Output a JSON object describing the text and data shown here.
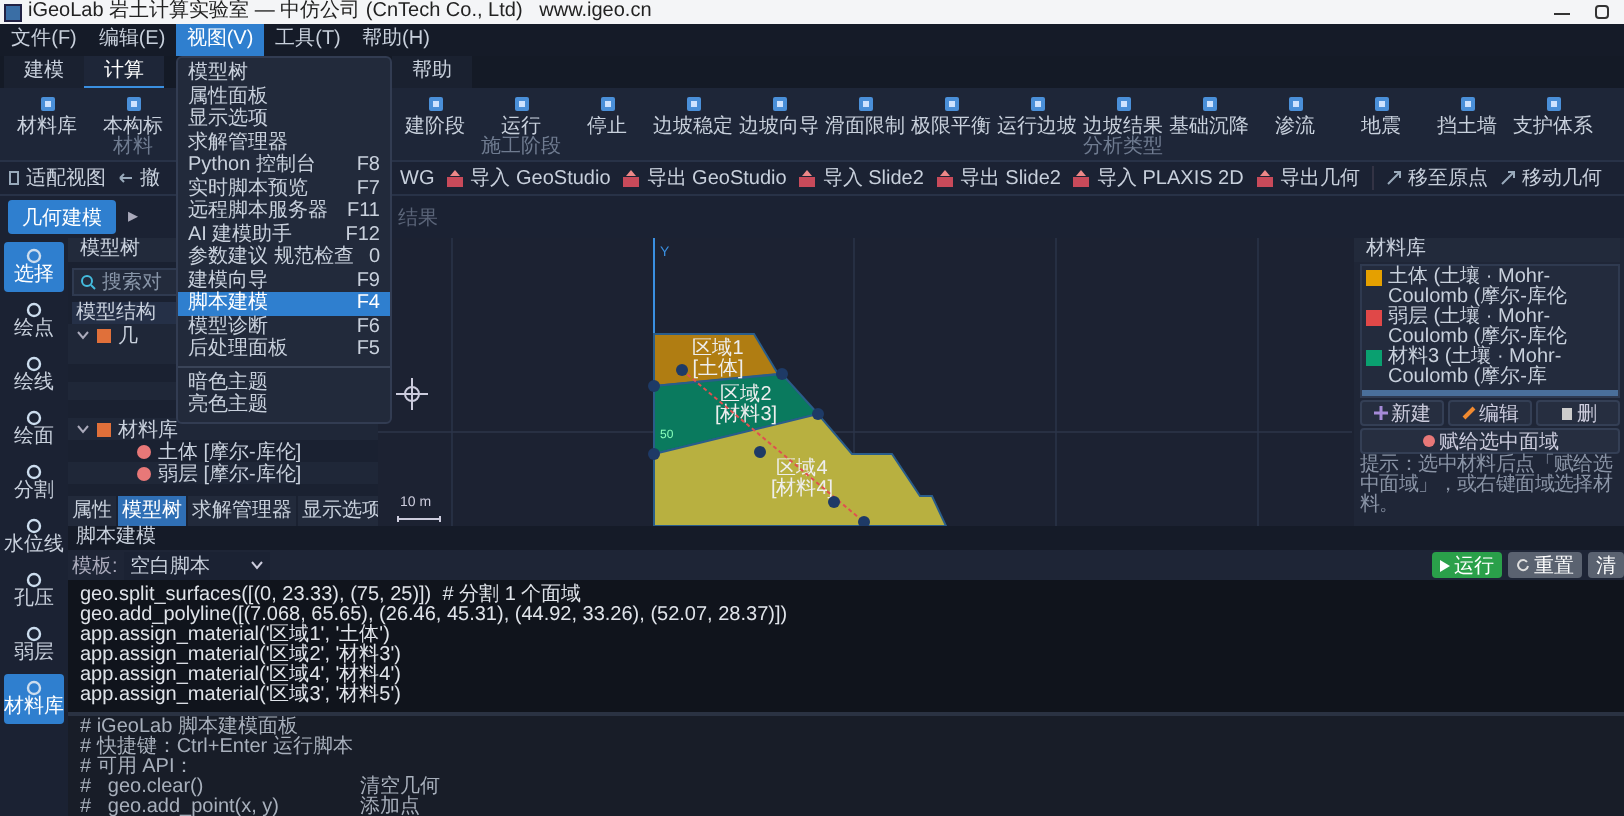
{
  "window": {
    "title": "iGeoLab 岩土计算实验室 — 中仿公司 (CnTech Co., Ltd)   www.igeo.cn"
  },
  "menu": [
    {
      "label": "文件(F)",
      "selected": false
    },
    {
      "label": "编辑(E)",
      "selected": false
    },
    {
      "label": "视图(V)",
      "selected": true
    },
    {
      "label": "工具(T)",
      "selected": false
    },
    {
      "label": "帮助(H)",
      "selected": false
    }
  ],
  "view_menu": {
    "groups": [
      [
        {
          "label": "模型树",
          "selected": false
        },
        {
          "label": "属性面板",
          "selected": false
        },
        {
          "label": "显示选项",
          "selected": false
        },
        {
          "label": "求解管理器",
          "selected": false
        },
        {
          "label": "Python 控制台",
          "shortcut": "F8",
          "selected": false
        },
        {
          "label": "实时脚本预览",
          "shortcut": "F7",
          "selected": false
        },
        {
          "label": "远程脚本服务器",
          "shortcut": "F11",
          "selected": false
        },
        {
          "label": "AI 建模助手",
          "shortcut": "F12",
          "selected": false
        },
        {
          "label": "参数建议  规范检查",
          "shortcut": "0",
          "selected": false
        },
        {
          "label": "建模向导",
          "shortcut": "F9",
          "selected": false
        },
        {
          "label": "脚本建模",
          "shortcut": "F4",
          "selected": true
        },
        {
          "label": "模型诊断",
          "shortcut": "F6",
          "selected": false
        },
        {
          "label": "后处理面板",
          "shortcut": "F5",
          "selected": false
        }
      ],
      [
        {
          "label": "暗色主题",
          "selected": false
        },
        {
          "label": "亮色主题",
          "selected": false
        }
      ]
    ]
  },
  "ribbon_tabs": [
    {
      "label": "建模",
      "selected": false
    },
    {
      "label": "计算",
      "selected": true
    },
    {
      "label": "帮助",
      "selected": false
    }
  ],
  "ribbon_tools": [
    {
      "label": "材料库"
    },
    {
      "label": "本构标",
      "group_label": "材料"
    },
    {
      "label": "建阶段"
    },
    {
      "label": "运行",
      "group_label": "施工阶段"
    },
    {
      "label": "停止"
    },
    {
      "label": "边坡稳定"
    },
    {
      "label": "边坡向导"
    },
    {
      "label": "滑面限制"
    },
    {
      "label": "极限平衡"
    },
    {
      "label": "运行边坡"
    },
    {
      "label": "边坡结果",
      "group_label": "分析类型"
    },
    {
      "label": "基础沉降"
    },
    {
      "label": "渗流"
    },
    {
      "label": "地震"
    },
    {
      "label": "挡土墙"
    },
    {
      "label": "支护体系"
    }
  ],
  "toolbar": [
    {
      "label": "适配视图",
      "kind": "fit"
    },
    {
      "label": "撤",
      "kind": "undo"
    },
    {
      "label": "WG",
      "kind": "text"
    },
    {
      "label": "导入 GeoStudio",
      "kind": "file"
    },
    {
      "label": "导出 GeoStudio",
      "kind": "file"
    },
    {
      "label": "导入 Slide2",
      "kind": "file"
    },
    {
      "label": "导出 Slide2",
      "kind": "file"
    },
    {
      "label": "导入 PLAXIS 2D",
      "kind": "file"
    },
    {
      "label": "导出几何",
      "kind": "file"
    },
    {
      "label": "移至原点",
      "kind": "move"
    },
    {
      "label": "移动几何",
      "kind": "move"
    }
  ],
  "mode_bar": {
    "button": "几何建模",
    "arrow": "▸",
    "next": "结果"
  },
  "left_rail": [
    {
      "label": "选择",
      "selected": true
    },
    {
      "label": "绘点",
      "selected": false
    },
    {
      "label": "绘线",
      "selected": false
    },
    {
      "label": "绘面",
      "selected": false
    },
    {
      "label": "分割",
      "selected": false
    },
    {
      "label": "水位线",
      "selected": false
    },
    {
      "label": "孔压",
      "selected": false
    },
    {
      "label": "弱层",
      "selected": false
    },
    {
      "label": "材料库",
      "selected": true
    }
  ],
  "model_tree": {
    "title": "模型树",
    "search": {
      "placeholder": "搜索对"
    },
    "header": "模型结构",
    "nodes": [
      {
        "label": "几",
        "expanded": true
      },
      {
        "label": "材料库",
        "expanded": true,
        "children": [
          {
            "label": "土体",
            "model": "[摩尔-库伦]"
          },
          {
            "label": "弱层",
            "model": "[摩尔-库伦]"
          }
        ]
      }
    ],
    "tabs": [
      {
        "label": "属性",
        "selected": false
      },
      {
        "label": "模型树",
        "selected": true
      },
      {
        "label": "求解管理器",
        "selected": false
      },
      {
        "label": "显示选项",
        "selected": false
      }
    ]
  },
  "canvas": {
    "axis_label": "Y",
    "tick": "50",
    "scale": "10 m",
    "regions": [
      {
        "name": "区域1",
        "material": "[土体]",
        "color": "#b07d12"
      },
      {
        "name": "区域2",
        "material": "[材料3]",
        "color": "#0a7a5e"
      },
      {
        "name": "区域4",
        "material": "[材料4]",
        "color": "#b8b040"
      }
    ]
  },
  "materials": {
    "title": "材料库",
    "items": [
      {
        "name": "土体",
        "desc": "(土壤 · Mohr-Coulomb (摩尔-库伦",
        "color": "#e5a000"
      },
      {
        "name": "弱层",
        "desc": "(土壤 · Mohr-Coulomb (摩尔-库伦",
        "color": "#e04848"
      },
      {
        "name": "材料3",
        "desc": "(土壤 · Mohr-Coulomb (摩尔-库",
        "color": "#0aa070"
      }
    ],
    "buttons": [
      {
        "label": "新建",
        "kind": "add"
      },
      {
        "label": "编辑",
        "kind": "edit"
      },
      {
        "label": "删",
        "kind": "delete"
      }
    ],
    "assign_button": "赋给选中面域",
    "hint": "提示：选中材料后点「赋给选中面域」，或右键面域选择材料。"
  },
  "script": {
    "title": "脚本建模",
    "template_label": "模板:",
    "template": "空白脚本",
    "buttons": [
      {
        "label": "运行",
        "kind": "run"
      },
      {
        "label": "重置",
        "kind": "reset"
      },
      {
        "label": "清",
        "kind": "plain"
      }
    ],
    "code": [
      "geo.split_surfaces([(0, 23.33), (75, 25)])  # 分割 1 个面域",
      "geo.add_polyline([(7.068, 65.65), (26.46, 45.31), (44.92, 33.26), (52.07, 28.37)])",
      "app.assign_material('区域1', '土体')",
      "app.assign_material('区域2', '材料3')",
      "app.assign_material('区域4', '材料4')",
      "app.assign_material('区域3', '材料5')"
    ],
    "comments": [
      {
        "code": "# iGeoLab 脚本建模面板"
      },
      {
        "code": "# 快捷键：Ctrl+Enter 运行脚本"
      },
      {
        "code": "# 可用 API："
      },
      {
        "code": "#   geo.clear()",
        "note": "清空几何"
      },
      {
        "code": "#   geo.add_point(x, y)",
        "note": "添加点"
      }
    ]
  }
}
